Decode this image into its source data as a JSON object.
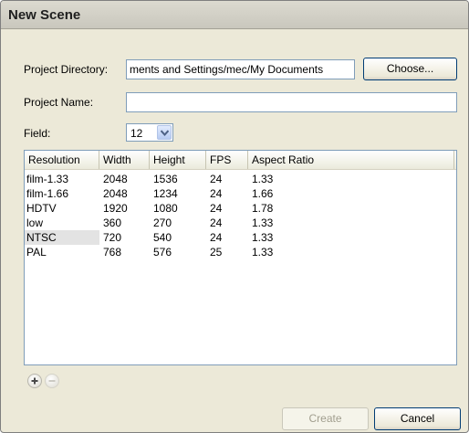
{
  "window": {
    "title": "New Scene"
  },
  "form": {
    "project_directory_label": "Project Directory:",
    "project_directory_value": "ments and Settings/mec/My Documents",
    "choose_label": "Choose...",
    "project_name_label": "Project Name:",
    "project_name_value": "",
    "field_label": "Field:",
    "field_value": "12"
  },
  "table": {
    "columns": [
      "Resolution",
      "Width",
      "Height",
      "FPS",
      "Aspect Ratio"
    ],
    "rows": [
      [
        "film-1.33",
        "2048",
        "1536",
        "24",
        "1.33"
      ],
      [
        "film-1.66",
        "2048",
        "1234",
        "24",
        "1.66"
      ],
      [
        "HDTV",
        "1920",
        "1080",
        "24",
        "1.78"
      ],
      [
        "low",
        "360",
        "270",
        "24",
        "1.33"
      ],
      [
        "NTSC",
        "720",
        "540",
        "24",
        "1.33"
      ],
      [
        "PAL",
        "768",
        "576",
        "25",
        "1.33"
      ]
    ],
    "selected_row": 4
  },
  "icons": {
    "add": "plus-icon",
    "remove": "minus-icon",
    "dropdown": "chevron-down-icon"
  },
  "footer": {
    "create_label": "Create",
    "cancel_label": "Cancel"
  },
  "colors": {
    "dialog_bg": "#ece9d8",
    "field_border": "#7f9db9",
    "selection": "#e3e3e3"
  }
}
